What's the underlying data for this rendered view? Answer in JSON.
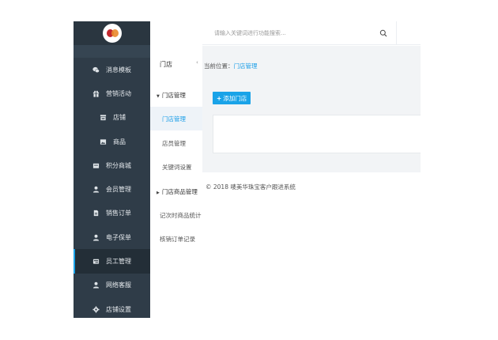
{
  "sidebar": {
    "items": [
      {
        "label": "消息模板",
        "icon": "wechat-icon",
        "sub": false,
        "active": false
      },
      {
        "label": "营销活动",
        "icon": "gift-icon",
        "sub": false,
        "active": false
      },
      {
        "label": "店铺",
        "icon": "store-icon",
        "sub": true,
        "active": false
      },
      {
        "label": "商品",
        "icon": "image-icon",
        "sub": true,
        "active": false
      },
      {
        "label": "积分商城",
        "icon": "wallet-icon",
        "sub": false,
        "active": false
      },
      {
        "label": "会员管理",
        "icon": "user-icon",
        "sub": false,
        "active": false
      },
      {
        "label": "销售订单",
        "icon": "document-icon",
        "sub": false,
        "active": false
      },
      {
        "label": "电子保单",
        "icon": "user-icon",
        "sub": false,
        "active": false
      },
      {
        "label": "员工管理",
        "icon": "staff-icon",
        "sub": false,
        "active": true
      },
      {
        "label": "网络客服",
        "icon": "user-icon",
        "sub": false,
        "active": false
      },
      {
        "label": "店铺设置",
        "icon": "gear-icon",
        "sub": false,
        "active": false
      }
    ]
  },
  "submenu": {
    "title": "门店",
    "collapse_glyph": "‹",
    "group1": "门店管理",
    "group1_items": [
      "门店管理",
      "店员管理",
      "关键词设置"
    ],
    "group2": "门店商品管理",
    "extra_items": [
      "记次时商品统计",
      "核销订单记录"
    ]
  },
  "header": {
    "search_placeholder": "请输入关键词进行功能搜索..."
  },
  "content": {
    "breadcrumb_prefix": "当前位置：",
    "breadcrumb_link": "门店管理",
    "add_button": "添加门店",
    "footer": "© 2018 唛美华珠宝客户跟进系统"
  },
  "colors": {
    "sidebar_bg": "#2f3c48",
    "accent": "#1aa3e8",
    "content_bg": "#f2f4f6"
  }
}
